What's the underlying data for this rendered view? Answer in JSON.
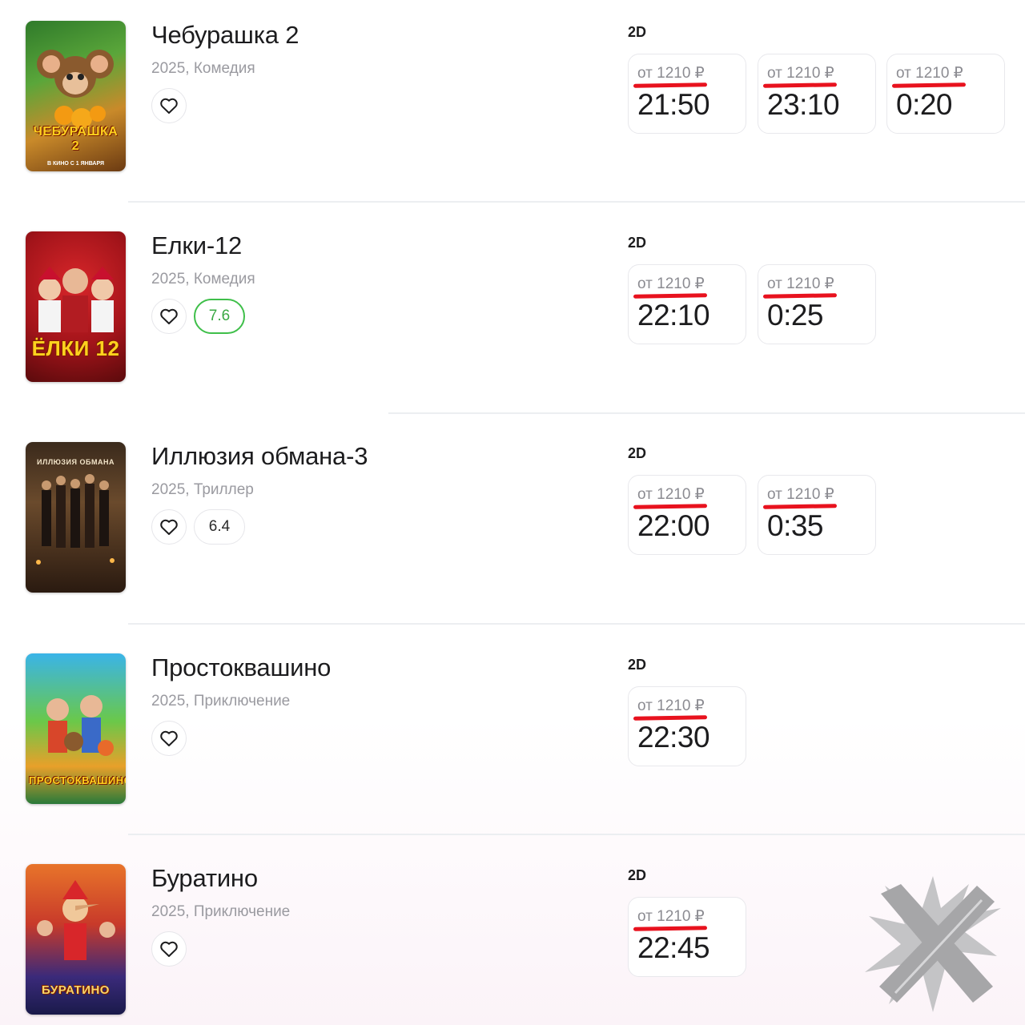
{
  "accent_color": "#e8121e",
  "rating_good_color": "#3fbf4a",
  "movies": [
    {
      "title": "Чебурашка 2",
      "meta": "2025, Комедия",
      "rating": null,
      "poster_title": "ЧЕБУРАШКА 2",
      "poster_sub": "В КИНО С 1 ЯНВАРЯ",
      "format": "2D",
      "showtimes": [
        {
          "price": "от 1210 ₽",
          "time": "21:50"
        },
        {
          "price": "от 1210 ₽",
          "time": "23:10"
        },
        {
          "price": "от 1210 ₽",
          "time": "0:20"
        }
      ]
    },
    {
      "title": "Елки-12",
      "meta": "2025, Комедия",
      "rating": "7.6",
      "poster_title": "ЁЛКИ 12",
      "poster_sub": "",
      "format": "2D",
      "showtimes": [
        {
          "price": "от 1210 ₽",
          "time": "22:10"
        },
        {
          "price": "от 1210 ₽",
          "time": "0:25"
        }
      ]
    },
    {
      "title": "Иллюзия обмана-3",
      "meta": "2025, Триллер",
      "rating": "6.4",
      "poster_title": "ИЛЛЮЗИЯ ОБМАНА",
      "poster_sub": "",
      "format": "2D",
      "showtimes": [
        {
          "price": "от 1210 ₽",
          "time": "22:00"
        },
        {
          "price": "от 1210 ₽",
          "time": "0:35"
        }
      ]
    },
    {
      "title": "Простоквашино",
      "meta": "2025, Приключение",
      "rating": null,
      "poster_title": "ПРОСТОКВАШИНО",
      "poster_sub": "",
      "format": "2D",
      "showtimes": [
        {
          "price": "от 1210 ₽",
          "time": "22:30"
        }
      ]
    },
    {
      "title": "Буратино",
      "meta": "2025, Приключение",
      "rating": null,
      "poster_title": "БУРАТИНО",
      "poster_sub": "",
      "format": "2D",
      "showtimes": [
        {
          "price": "от 1210 ₽",
          "time": "22:45"
        }
      ]
    }
  ]
}
